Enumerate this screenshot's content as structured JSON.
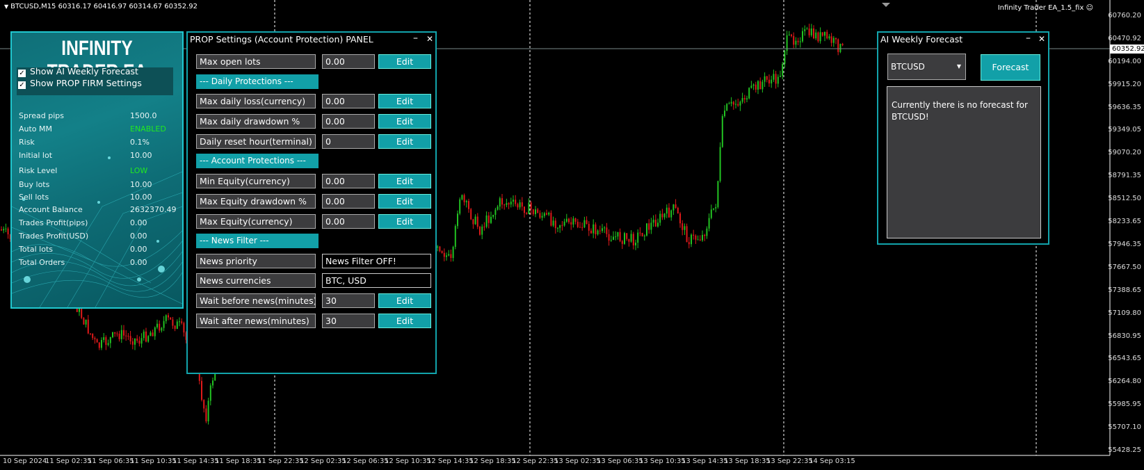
{
  "chart": {
    "symbol_line": "BTCUSD,M15  60316.17 60416.97 60314.67 60352.92",
    "ea_label": "Infinity Trader EA_1.5_fix",
    "current_price": "60352.92",
    "price_ticks": [
      "60760.20",
      "60470.92",
      "60194.00",
      "59915.20",
      "59636.35",
      "59349.05",
      "59070.20",
      "58791.35",
      "58512.50",
      "58233.65",
      "57946.35",
      "57667.50",
      "57388.65",
      "57109.80",
      "56830.95",
      "56543.65",
      "56264.80",
      "55985.95",
      "55707.10",
      "55428.25"
    ],
    "time_ticks": [
      "10 Sep 2024",
      "11 Sep 02:35",
      "11 Sep 06:35",
      "11 Sep 10:35",
      "11 Sep 14:35",
      "11 Sep 18:35",
      "11 Sep 22:35",
      "12 Sep 02:35",
      "12 Sep 06:35",
      "12 Sep 10:35",
      "12 Sep 14:35",
      "12 Sep 18:35",
      "12 Sep 22:35",
      "13 Sep 02:35",
      "13 Sep 06:35",
      "13 Sep 10:35",
      "13 Sep 14:35",
      "13 Sep 18:35",
      "13 Sep 22:35",
      "14 Sep 03:15"
    ],
    "colors": {
      "bull": "#22c322",
      "bear": "#e01a1a",
      "grid": "#ffffff"
    }
  },
  "infinity": {
    "title": "INFINITY TRADER EA",
    "checkboxes": [
      {
        "label": "Show AI Weekly Forecast",
        "checked": "✓"
      },
      {
        "label": "Show PROP FIRM Settings",
        "checked": "✓"
      }
    ],
    "stats": [
      {
        "label": "Spread pips",
        "value": "1500.0"
      },
      {
        "label": "Auto MM",
        "value": "ENABLED"
      },
      {
        "label": "Risk",
        "value": "0.1%"
      },
      {
        "label": "Initial lot",
        "value": "10.00"
      },
      {
        "label": "Risk Level",
        "value": "LOW"
      },
      {
        "label": "Buy lots",
        "value": "10.00"
      },
      {
        "label": "Sell lots",
        "value": "10.00"
      },
      {
        "label": "Account Balance",
        "value": "2632370.49"
      },
      {
        "label": "Trades Profit(pips)",
        "value": "0.00"
      },
      {
        "label": "Trades Profit(USD)",
        "value": "0.00"
      },
      {
        "label": "Total lots",
        "value": "0.00"
      },
      {
        "label": "Total Orders",
        "value": "0.00"
      }
    ]
  },
  "prop": {
    "title": "PROP Settings (Account Protection) PANEL",
    "minimize": "–",
    "close": "✕",
    "edit_label": "Edit",
    "rows": {
      "max_open_lots": {
        "label": "Max open lots",
        "value": "0.00"
      },
      "daily_header": "--- Daily Protections ---",
      "max_daily_loss": {
        "label": "Max daily loss(currency)",
        "value": "0.00"
      },
      "max_daily_dd": {
        "label": "Max daily drawdown %",
        "value": "0.00"
      },
      "daily_reset": {
        "label": "Daily reset hour(terminal)",
        "value": "0"
      },
      "account_header": "--- Account Protections ---",
      "min_equity": {
        "label": "Min Equity(currency)",
        "value": "0.00"
      },
      "max_equity_dd": {
        "label": "Max Equity drawdown %",
        "value": "0.00"
      },
      "max_equity": {
        "label": "Max Equity(currency)",
        "value": "0.00"
      },
      "news_header": "--- News Filter ---",
      "news_priority": {
        "label": "News priority",
        "value": "News Filter OFF!"
      },
      "news_currencies": {
        "label": "News currencies",
        "value": "BTC, USD"
      },
      "wait_before": {
        "label": "Wait before news(minutes)",
        "value": "30"
      },
      "wait_after": {
        "label": "Wait after news(minutes)",
        "value": "30"
      }
    }
  },
  "forecast": {
    "title": "AI Weekly Forecast",
    "minimize": "–",
    "close": "✕",
    "symbol": "BTCUSD",
    "button": "Forecast",
    "message": "Currently there is no forecast for BTCUSD!"
  }
}
